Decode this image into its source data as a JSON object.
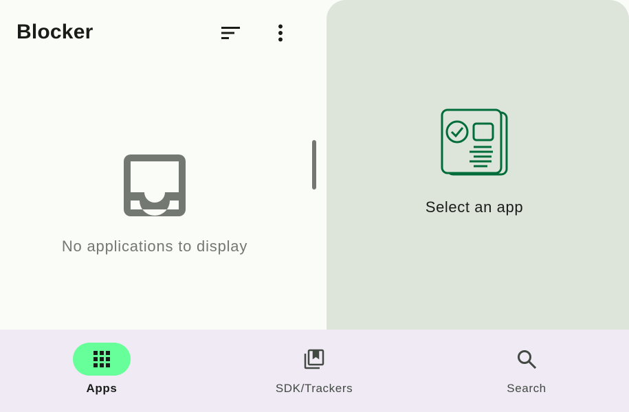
{
  "header": {
    "title": "Blocker",
    "sort_icon": "sort-icon",
    "more_icon": "more-vert-icon"
  },
  "list_pane": {
    "empty_icon": "inbox-icon",
    "empty_message": "No applications to display"
  },
  "detail_pane": {
    "icon": "app-details-icon",
    "message": "Select an app"
  },
  "bottom_nav": {
    "items": [
      {
        "label": "Apps",
        "icon": "apps-grid-icon",
        "selected": true
      },
      {
        "label": "SDK/Trackers",
        "icon": "library-books-icon",
        "selected": false
      },
      {
        "label": "Search",
        "icon": "search-icon",
        "selected": false
      }
    ]
  },
  "colors": {
    "background": "#fafcf7",
    "detail_background": "#dde5db",
    "nav_background": "#f0eaf5",
    "active_indicator": "#66ff99",
    "accent_green": "#006c3a",
    "muted_text": "#737873"
  }
}
